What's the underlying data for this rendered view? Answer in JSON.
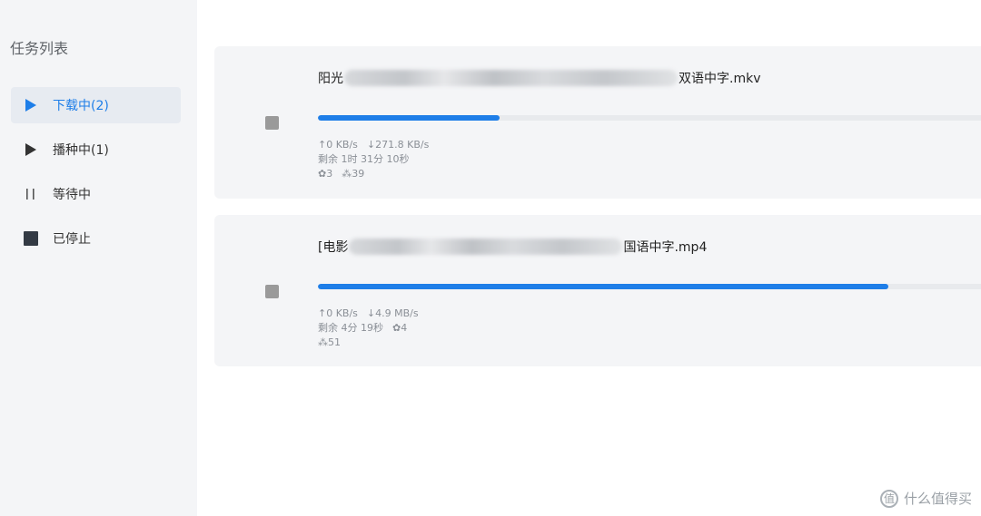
{
  "sidebar": {
    "title": "任务列表",
    "items": [
      {
        "label": "下载中(2)",
        "icon": "play-icon",
        "active": true
      },
      {
        "label": "播种中(1)",
        "icon": "play-icon",
        "active": false
      },
      {
        "label": "等待中",
        "icon": "pause-icon",
        "active": false
      },
      {
        "label": "已停止",
        "icon": "stop-square-icon",
        "active": false
      }
    ]
  },
  "colors": {
    "accent": "#1e7ee8",
    "sidebar_bg": "#f4f5f7",
    "card_bg": "#f4f5f7",
    "progress_track": "#e8eaed",
    "stop_button": "#9a9a9a",
    "meta_text": "#8a8f96"
  },
  "tasks": [
    {
      "name_prefix": "阳光",
      "name_suffix": "双语中字.mkv",
      "progress": 0.27,
      "upload_speed": "↑0 KB/s",
      "download_speed": "↓271.8 KB/s",
      "remaining": "剩余 1时 31分 10秒",
      "seeds": "✿3",
      "peers": "⁂39"
    },
    {
      "name_prefix": "[电影",
      "name_suffix": "国语中字.mp4",
      "progress": 0.85,
      "upload_speed": "↑0 KB/s",
      "download_speed": "↓4.9 MB/s",
      "remaining": "剩余 4分 19秒",
      "seeds": "✿4",
      "peers": "⁂51"
    }
  ],
  "watermark": {
    "icon_text": "值",
    "text": "什么值得买"
  }
}
